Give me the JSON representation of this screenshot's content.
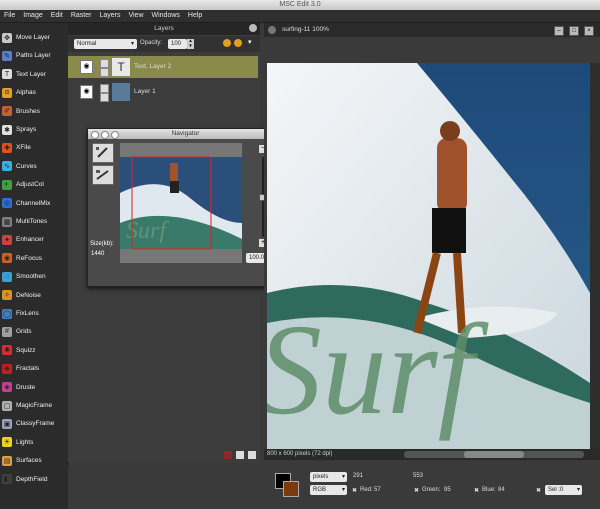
{
  "app_title": "MSC Edit 3.0",
  "menu": [
    "File",
    "Image",
    "Edit",
    "Raster",
    "Layers",
    "View",
    "Windows",
    "Help"
  ],
  "tools": [
    {
      "label": "Move Layer",
      "color": "#c8c8c8",
      "glyph": "✥"
    },
    {
      "label": "Paths Layer",
      "color": "#5a7ec8",
      "glyph": "✎"
    },
    {
      "label": "Text Layer",
      "color": "#dddddd",
      "glyph": "T"
    },
    {
      "label": "Alphas",
      "color": "#e0a020",
      "glyph": "α"
    },
    {
      "label": "Brushes",
      "color": "#c86030",
      "glyph": "✐"
    },
    {
      "label": "Sprays",
      "color": "#e0e0e0",
      "glyph": "✱"
    },
    {
      "label": "XFile",
      "color": "#e05020",
      "glyph": "✚"
    },
    {
      "label": "Curves",
      "color": "#3ab0e0",
      "glyph": "∿"
    },
    {
      "label": "AdjustCol",
      "color": "#3aa040",
      "glyph": "◐"
    },
    {
      "label": "ChannelMix",
      "color": "#2a70d0",
      "glyph": "◎"
    },
    {
      "label": "MultiTones",
      "color": "#808080",
      "glyph": "▦"
    },
    {
      "label": "Enhancer",
      "color": "#d04040",
      "glyph": "✦"
    },
    {
      "label": "ReFocus",
      "color": "#d06020",
      "glyph": "◉"
    },
    {
      "label": "Smoothen",
      "color": "#3aa0d0",
      "glyph": "◌"
    },
    {
      "label": "DeNoise",
      "color": "#e09020",
      "glyph": "✧"
    },
    {
      "label": "FixLens",
      "color": "#4080c0",
      "glyph": "◯"
    },
    {
      "label": "Grids",
      "color": "#a0a0a0",
      "glyph": "#"
    },
    {
      "label": "Squizz",
      "color": "#d03030",
      "glyph": "✺"
    },
    {
      "label": "Fractals",
      "color": "#c02020",
      "glyph": "❋"
    },
    {
      "label": "Druste",
      "color": "#c04090",
      "glyph": "◈"
    },
    {
      "label": "MagicFrame",
      "color": "#b0b0b0",
      "glyph": "▢"
    },
    {
      "label": "ClassyFrame",
      "color": "#a0a0c0",
      "glyph": "▣"
    },
    {
      "label": "Lights",
      "color": "#f0d020",
      "glyph": "☀"
    },
    {
      "label": "Surfaces",
      "color": "#e0a040",
      "glyph": "▤"
    },
    {
      "label": "DepthField",
      "color": "#404040",
      "glyph": "◧"
    }
  ],
  "layers_panel": {
    "title": "Layers",
    "blend_mode": "Normal",
    "opacity_label": "Opacity:",
    "opacity_value": "100",
    "layers": [
      {
        "name": "Text, Layer 2",
        "selected": true,
        "thumb": "T"
      },
      {
        "name": "Layer 1",
        "selected": false,
        "thumb": ""
      }
    ]
  },
  "navigator": {
    "title": "Navigator",
    "size_label": "Size(kb):",
    "size_value": "1440",
    "zoom_value": "100.00"
  },
  "image_window": {
    "title": "surfing-11 100%",
    "status": "800 x 600 pixels (72 dpi)",
    "overlay_text": "Surf"
  },
  "bottom_bar": {
    "unit": "pixels",
    "mode": "RGB",
    "x": "291",
    "y": "553",
    "red_label": "Red:",
    "red": "57",
    "green_label": "Green:",
    "green": "95",
    "blue_label": "Blue:",
    "blue": "84",
    "sel_label": "Sel :0",
    "fg_color": "#000000",
    "bg_color": "#7a3a10"
  }
}
